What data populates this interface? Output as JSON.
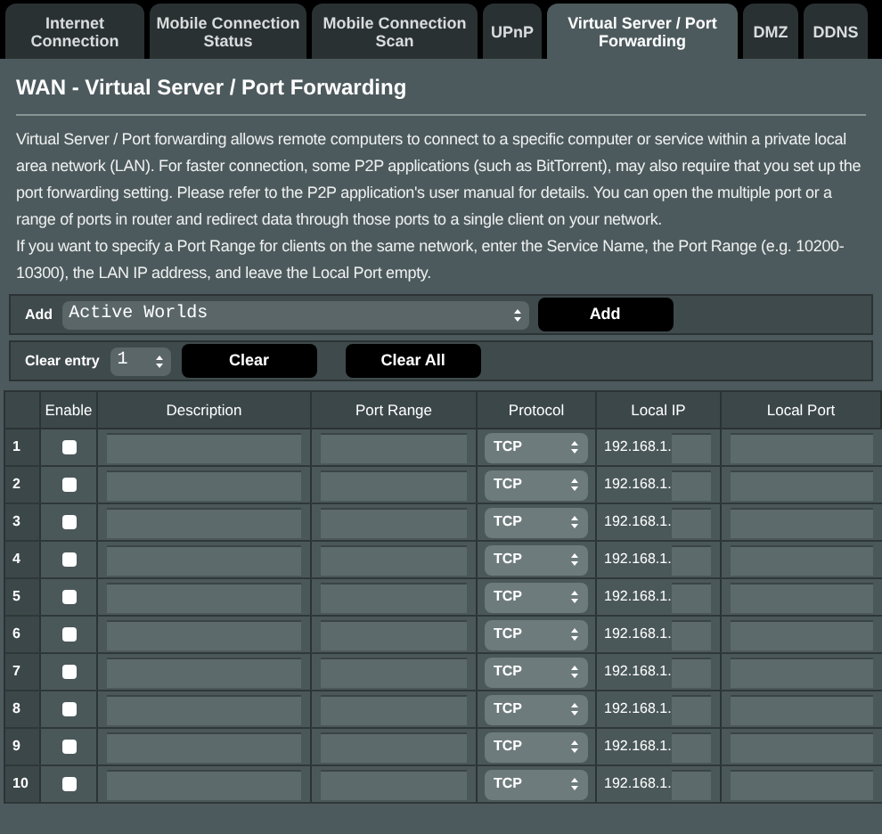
{
  "tabs": [
    {
      "label": "Internet Connection",
      "selected": false
    },
    {
      "label": "Mobile Connection Status",
      "selected": false
    },
    {
      "label": "Mobile Connection Scan",
      "selected": false
    },
    {
      "label": "UPnP",
      "selected": false
    },
    {
      "label": "Virtual Server / Port Forwarding",
      "selected": true
    },
    {
      "label": "DMZ",
      "selected": false
    },
    {
      "label": "DDNS",
      "selected": false
    }
  ],
  "title": "WAN - Virtual Server / Port Forwarding",
  "paragraphs": [
    "Virtual Server / Port forwarding allows remote computers to connect to a specific computer or service within a private local area network (LAN). For faster connection, some P2P applications (such as BitTorrent), may also require that you set up the port forwarding setting. Please refer to the P2P application's user manual for details. You can open the multiple port or a range of ports in router and redirect data through those ports to a single client on your network.",
    "If you want to specify a Port Range for clients on the same network, enter the Service Name, the Port Range (e.g. 10200-10300), the LAN IP address, and leave the Local Port empty."
  ],
  "add_bar": {
    "label": "Add",
    "service": "Active Worlds",
    "button": "Add"
  },
  "clear_bar": {
    "label": "Clear entry",
    "entry": "1",
    "clear_button": "Clear",
    "clear_all_button": "Clear All"
  },
  "table": {
    "columns": [
      "Enable",
      "Description",
      "Port Range",
      "Protocol",
      "Local IP",
      "Local Port"
    ],
    "rows": [
      {
        "number": "1",
        "enabled": false,
        "protocol": "TCP",
        "ip_prefix": "192.168.1."
      },
      {
        "number": "2",
        "enabled": false,
        "protocol": "TCP",
        "ip_prefix": "192.168.1."
      },
      {
        "number": "3",
        "enabled": false,
        "protocol": "TCP",
        "ip_prefix": "192.168.1."
      },
      {
        "number": "4",
        "enabled": false,
        "protocol": "TCP",
        "ip_prefix": "192.168.1."
      },
      {
        "number": "5",
        "enabled": false,
        "protocol": "TCP",
        "ip_prefix": "192.168.1."
      },
      {
        "number": "6",
        "enabled": false,
        "protocol": "TCP",
        "ip_prefix": "192.168.1."
      },
      {
        "number": "7",
        "enabled": false,
        "protocol": "TCP",
        "ip_prefix": "192.168.1."
      },
      {
        "number": "8",
        "enabled": false,
        "protocol": "TCP",
        "ip_prefix": "192.168.1."
      },
      {
        "number": "9",
        "enabled": false,
        "protocol": "TCP",
        "ip_prefix": "192.168.1."
      },
      {
        "number": "10",
        "enabled": false,
        "protocol": "TCP",
        "ip_prefix": "192.168.1."
      }
    ]
  }
}
